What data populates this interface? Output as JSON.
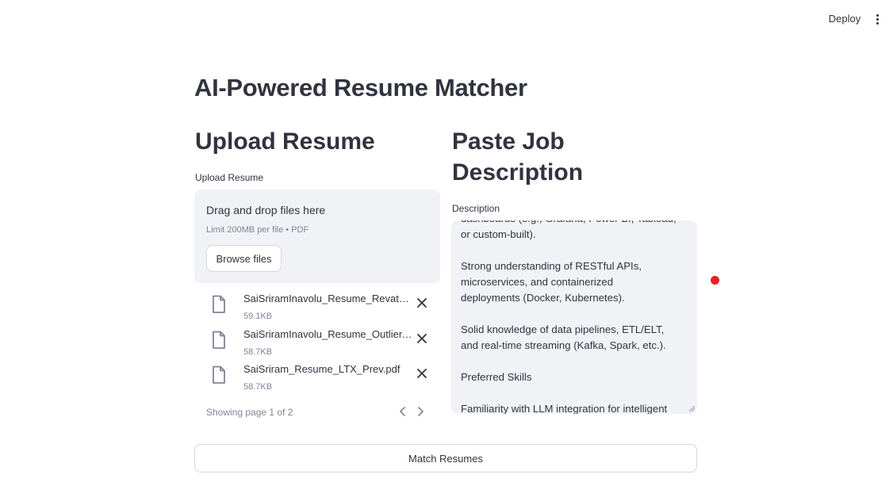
{
  "header": {
    "deploy_label": "Deploy",
    "menu_icon": "kebab-menu-icon"
  },
  "title": "AI-Powered Resume Matcher",
  "upload": {
    "heading": "Upload Resume",
    "label": "Upload Resume",
    "dropzone_title": "Drag and drop files here",
    "limit_text": "Limit 200MB per file • PDF",
    "browse_label": "Browse files",
    "files": [
      {
        "name": "SaiSriramInavolu_Resume_Revature.pdf",
        "size": "59.1KB",
        "icon": "file-icon"
      },
      {
        "name": "SaiSriramInavolu_Resume_Outlier.pdf",
        "size": "58.7KB",
        "icon": "file-icon"
      },
      {
        "name": "SaiSriram_Resume_LTX_Prev.pdf",
        "size": "58.7KB",
        "icon": "file-icon"
      }
    ],
    "pager_text": "Showing page 1 of 2"
  },
  "job": {
    "heading": "Paste Job Description",
    "label": "Description",
    "text": "dashboards (e.g., Grafana, Power BI, Tableau,\nor custom-built).\n\nStrong understanding of RESTful APIs,\nmicroservices, and containerized\ndeployments (Docker, Kubernetes).\n\nSolid knowledge of data pipelines, ETL/ELT,\nand real-time streaming (Kafka, Spark, etc.).\n\nPreferred Skills\n\nFamiliarity with LLM integration for intelligent"
  },
  "match_button_label": "Match Resumes",
  "colors": {
    "status_dot": "#e8202a",
    "panel_bg": "#f0f2f6",
    "text": "#31333f"
  }
}
